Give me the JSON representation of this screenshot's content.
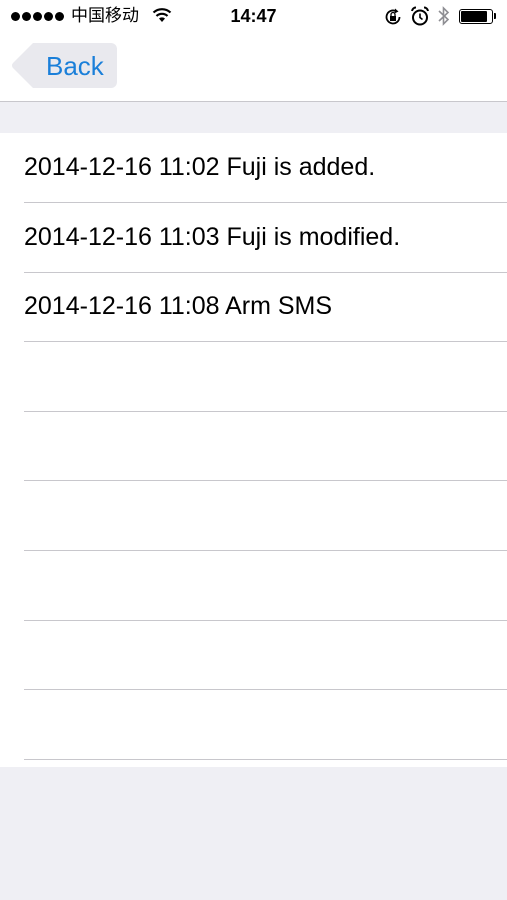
{
  "status_bar": {
    "carrier": "中国移动",
    "time": "14:47",
    "signal_icon": "signal-dots-icon",
    "wifi_icon": "wifi-icon",
    "rotation_lock_icon": "rotation-lock-icon",
    "alarm_icon": "alarm-icon",
    "bluetooth_icon": "bluetooth-icon",
    "battery_icon": "battery-icon",
    "battery_level": 0.85
  },
  "nav": {
    "back_label": "Back"
  },
  "log": {
    "items": [
      "2014-12-16 11:02 Fuji is added.",
      "2014-12-16 11:03 Fuji is modified.",
      "2014-12-16 11:08 Arm SMS",
      "",
      "",
      "",
      "",
      "",
      ""
    ]
  },
  "colors": {
    "tint": "#1a7fd9",
    "background": "#efeff4",
    "separator": "#c8c7cc"
  }
}
